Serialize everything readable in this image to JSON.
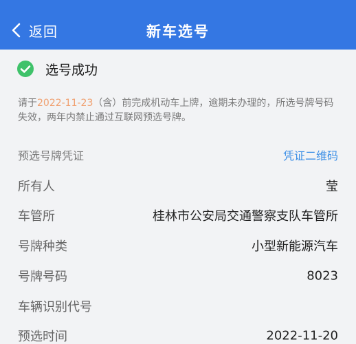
{
  "nav": {
    "back_label": "返回",
    "title": "新车选号"
  },
  "status": {
    "icon": "check-circle-icon",
    "label": "选号成功"
  },
  "notice": {
    "prefix": "请于",
    "date": "2022-11-23",
    "suffix": "（含）前完成机动车上牌，逾期未办理的，所选号牌号码失效，两年内禁止通过互联网预选号牌。"
  },
  "voucher": {
    "label": "预选号牌凭证",
    "link": "凭证二维码"
  },
  "details": [
    {
      "label": "所有人",
      "value": "莹"
    },
    {
      "label": "车管所",
      "value": "桂林市公安局交通警察支队车管所"
    },
    {
      "label": "号牌种类",
      "value": "小型新能源汽车"
    },
    {
      "label": "号牌号码",
      "value": "8023"
    },
    {
      "label": "车辆识别代号",
      "value": ""
    },
    {
      "label": "预选时间",
      "value": "2022-11-20"
    }
  ],
  "colors": {
    "nav_bg": "#3477e3",
    "success": "#3fc26a",
    "date_highlight": "#f0a070",
    "link": "#3a8ee6"
  }
}
